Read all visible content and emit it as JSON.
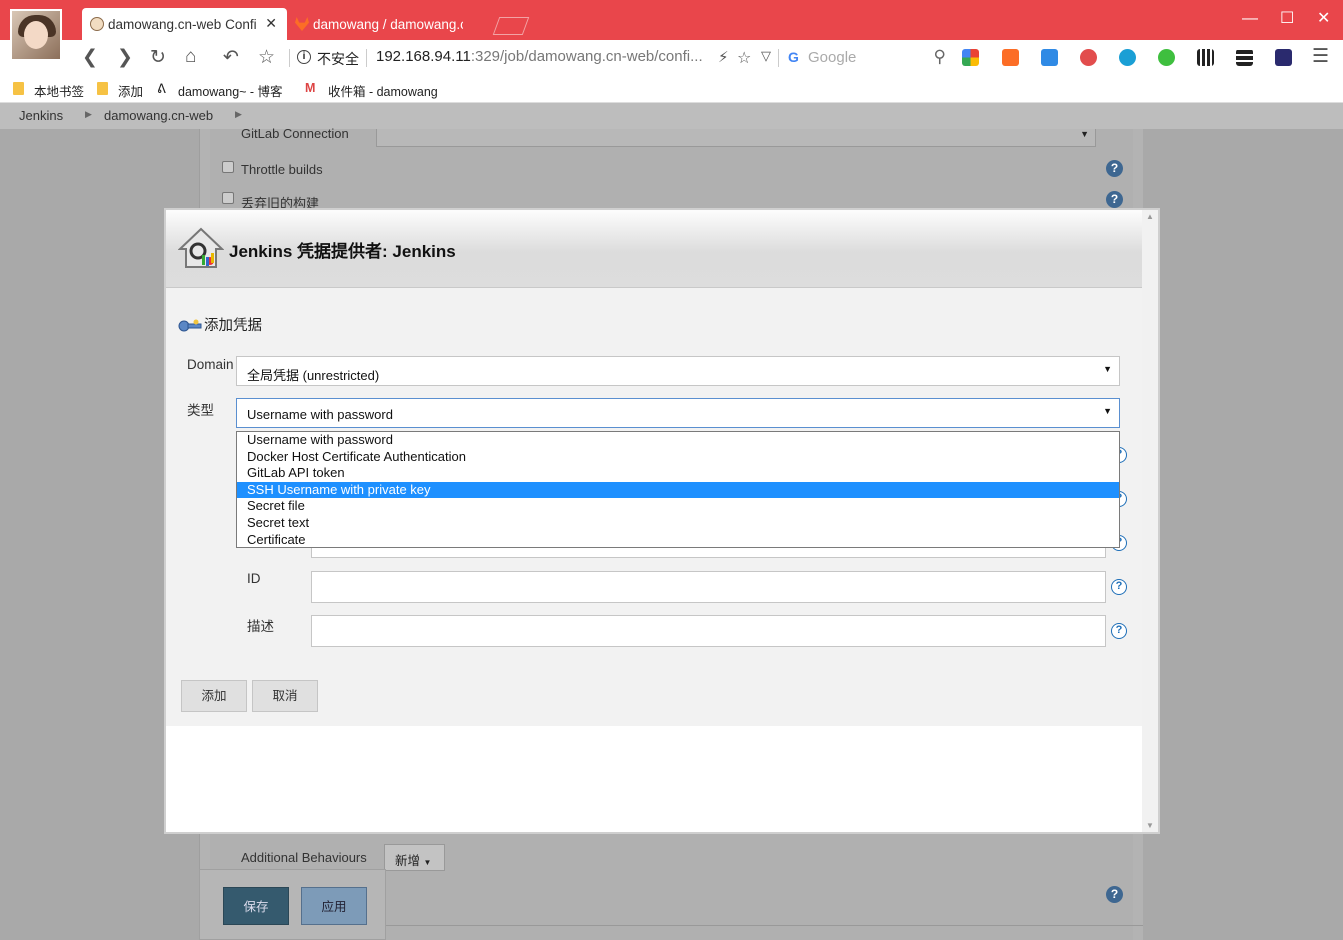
{
  "browser": {
    "tabs": [
      {
        "title": "damowang.cn-web Confi",
        "active": true
      },
      {
        "title": "damowang / damowang.cn-",
        "active": false
      }
    ],
    "security_label": "不安全",
    "url_host": "192.168.94.11",
    "url_rest": ":329/job/damowang.cn-web/confi...",
    "search_placeholder": "Google",
    "search_engine_letter": "G"
  },
  "bookmarks": [
    {
      "label": "本地书签"
    },
    {
      "label": "添加"
    },
    {
      "label": "damowang~ - 博客"
    },
    {
      "label": "收件箱 - damowang"
    }
  ],
  "breadcrumb": [
    "Jenkins",
    "damowang.cn-web"
  ],
  "config": {
    "gitlab_connection": "GitLab Connection",
    "throttle_builds": "Throttle builds",
    "discard_old": "丢弃旧的构建",
    "additional_behaviours": "Additional Behaviours",
    "new_button": "新增",
    "save_button": "保存",
    "apply_button": "应用"
  },
  "dialog": {
    "title": "Jenkins 凭据提供者: Jenkins",
    "section_title": "添加凭据",
    "domain_label": "Domain",
    "domain_value": "全局凭据 (unrestricted)",
    "kind_label": "类型",
    "kind_value": "Username with password",
    "kind_options": [
      "Username with password",
      "Docker Host Certificate Authentication",
      "GitLab API token",
      "SSH Username with private key",
      "Secret file",
      "Secret text",
      "Certificate"
    ],
    "highlighted_option_index": 3,
    "id_label": "ID",
    "description_label": "描述",
    "add_button": "添加",
    "cancel_button": "取消",
    "help_symbol": "?"
  },
  "colors": {
    "titlebar": "#e9464b",
    "dropdown_highlight": "#1e90ff",
    "help_icon": "#1f6fb8"
  }
}
